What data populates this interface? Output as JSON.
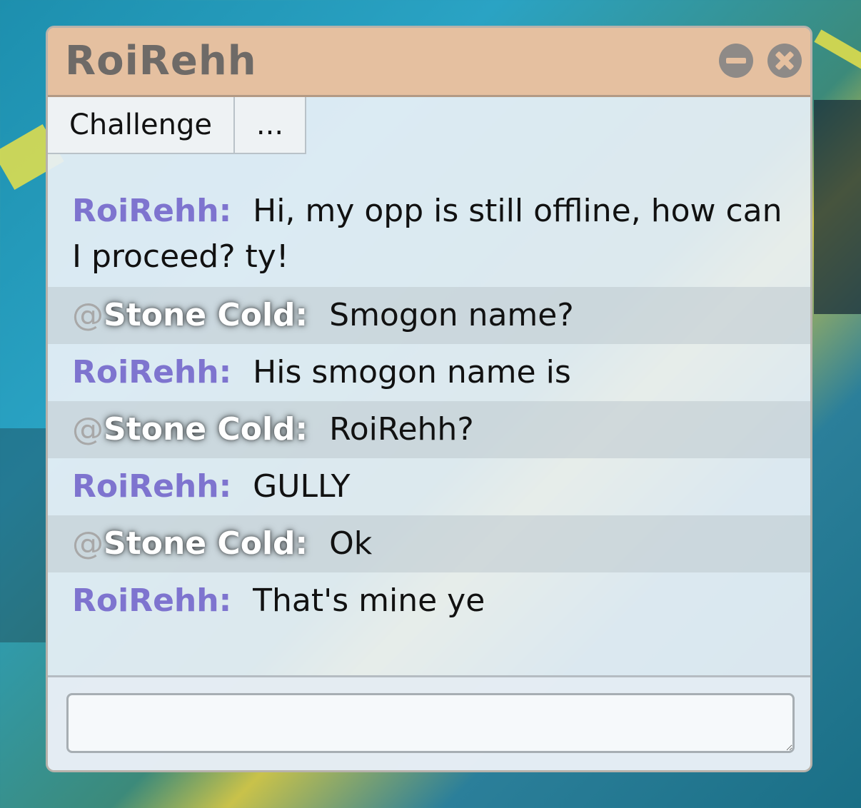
{
  "window": {
    "title": "RoiRehh",
    "minimize_icon": "minus-circle-icon",
    "close_icon": "close-circle-icon"
  },
  "toolbar": {
    "challenge_label": "Challenge",
    "more_label": "..."
  },
  "messages": [
    {
      "at": "",
      "user": "RoiRehh:",
      "text": "Hi, my opp is still offline, how can I proceed? ty!"
    },
    {
      "at": "@",
      "user": "Stone Cold:",
      "text": "Smogon name?"
    },
    {
      "at": "",
      "user": "RoiRehh:",
      "text": "His smogon name is"
    },
    {
      "at": "@",
      "user": "Stone Cold:",
      "text": "RoiRehh?"
    },
    {
      "at": "",
      "user": "RoiRehh:",
      "text": "GULLY"
    },
    {
      "at": "@",
      "user": "Stone Cold:",
      "text": "Ok"
    },
    {
      "at": "",
      "user": "RoiRehh:",
      "text": "That's mine ye"
    }
  ],
  "input": {
    "value": "",
    "placeholder": ""
  },
  "colors": {
    "titlebar": "#e5c0a0",
    "username": "#7e74cf"
  }
}
